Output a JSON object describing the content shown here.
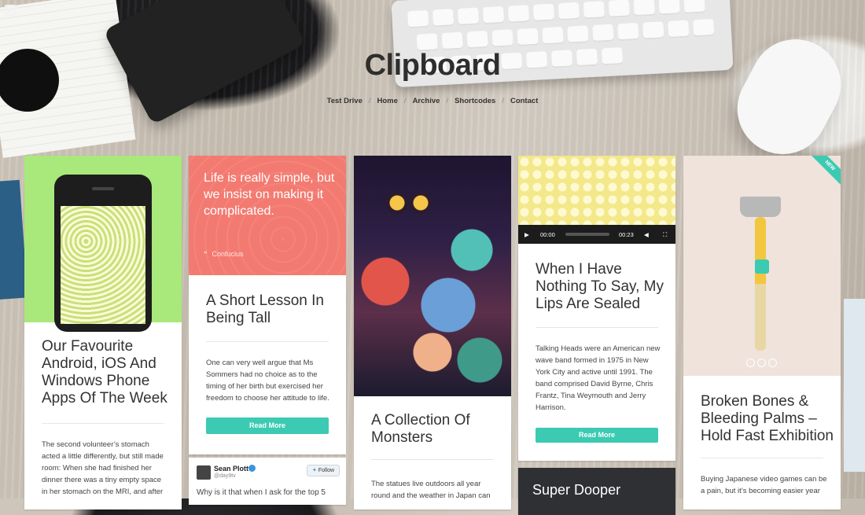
{
  "site": {
    "title": "Clipboard",
    "nav": [
      "Test Drive",
      "Home",
      "Archive",
      "Shortcodes",
      "Contact"
    ],
    "nav_separator": "/"
  },
  "colors": {
    "accent": "#3ccab2",
    "quote_bg": "#f37a70",
    "phone_bg": "#a9e87a",
    "bubbles_bg": "#f3e88a"
  },
  "cards": {
    "c1": {
      "title": "Our Favourite Android, iOS And Windows Phone Apps Of The Week",
      "excerpt": "The second volunteer’s stomach acted a little differently, but still made room: When she had finished her dinner there was a tiny empty space in her stomach on the MRI, and after"
    },
    "c2": {
      "quote": "Life is really simple, but we insist on making it complicated.",
      "quote_author": "Confucius",
      "title": "A Short Lesson In Being Tall",
      "excerpt": "One can very well argue that Ms Sommers had no choice as to the timing of her birth but exercised her freedom to choose her attitude to life.",
      "button": "Read More"
    },
    "tweet": {
      "name": "Sean Plott",
      "handle": "@day9tv",
      "follow": "Follow",
      "text": "Why is it that when I ask for the top 5"
    },
    "c3": {
      "title": "A Collection Of Monsters",
      "excerpt": "The statues live outdoors all year round and the weather in Japan can"
    },
    "c4": {
      "player_current": "00:00",
      "player_total": "00:23",
      "title": "When I Have Nothing To Say, My Lips Are Sealed",
      "excerpt": "Talking Heads were an American new wave band formed in 1975 in New York City and active until 1991. The band comprised David Byrne, Chris Frantz, Tina Weymouth and Jerry Harrison.",
      "button": "Read More"
    },
    "c5": {
      "title": "Super Dooper"
    },
    "c6": {
      "ribbon": "NEW",
      "title": "Broken Bones & Bleeding Palms – Hold Fast Exhibition",
      "excerpt": "Buying Japanese video games can be a pain, but it’s becoming easier year"
    }
  }
}
